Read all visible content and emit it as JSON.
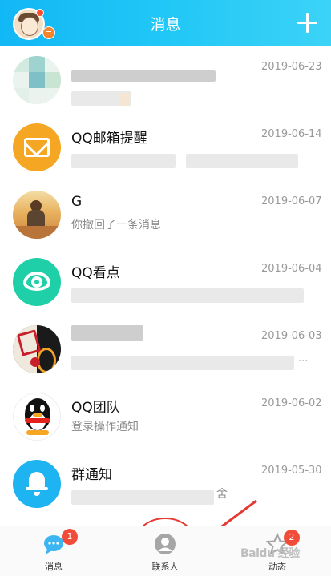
{
  "header": {
    "title": "消息",
    "plus_icon": "plus-icon",
    "accent_color": "#12b7f5"
  },
  "conversations": [
    {
      "name": "",
      "date": "2019-06-23",
      "preview": ""
    },
    {
      "name": "QQ邮箱提醒",
      "date": "2019-06-14",
      "preview": "",
      "avatar_icon": "mail-icon",
      "avatar_color": "#f5a623"
    },
    {
      "name": "G",
      "date": "2019-06-07",
      "preview": "你撤回了一条消息"
    },
    {
      "name": "QQ看点",
      "date": "2019-06-04",
      "preview": "",
      "avatar_icon": "eye-icon",
      "avatar_color": "#1fcfa7"
    },
    {
      "name": "",
      "date": "2019-06-03",
      "preview": "",
      "ellipsis": "..."
    },
    {
      "name": "QQ团队",
      "date": "2019-06-02",
      "preview": "登录操作通知",
      "avatar_icon": "penguin-icon"
    },
    {
      "name": "群通知",
      "date": "2019-05-30",
      "preview": "舍",
      "avatar_icon": "bell-icon",
      "avatar_color": "#1eb3f1"
    }
  ],
  "tabs": [
    {
      "label": "消息",
      "badge": "1"
    },
    {
      "label": "联系人"
    },
    {
      "label": "动态",
      "badge": "2"
    }
  ],
  "annotation": {
    "color": "#e53a33"
  },
  "watermark": {
    "text": "Baidu 经验",
    "sub": "jingyan"
  }
}
